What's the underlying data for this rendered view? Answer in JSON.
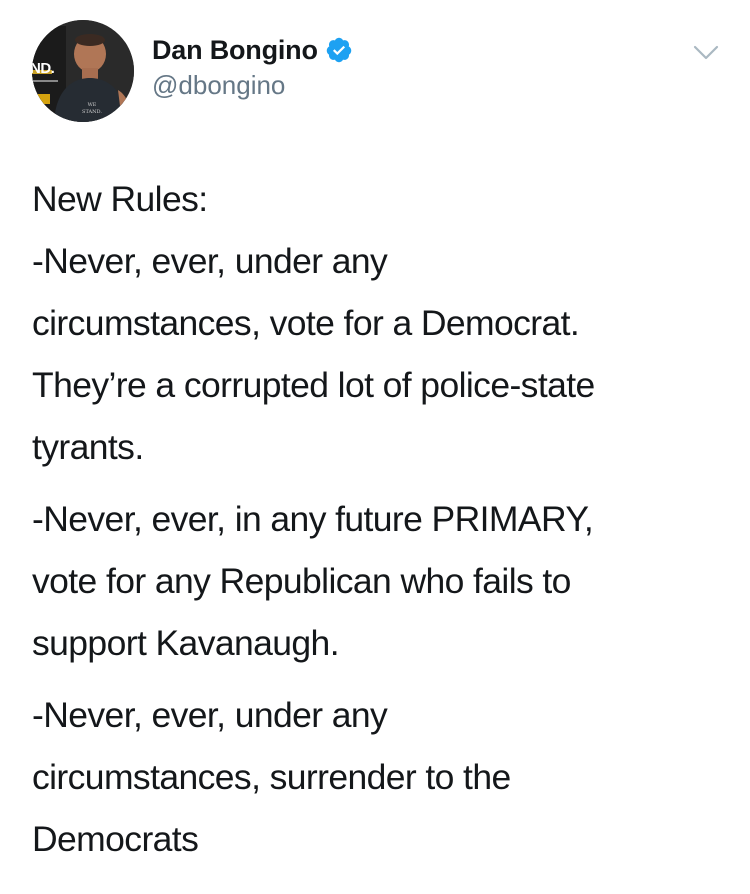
{
  "tweet": {
    "author": {
      "display_name": "Dan Bongino",
      "handle": "@dbongino",
      "verified": true,
      "avatar_text": "ND."
    },
    "menu_icon": "chevron-down-icon",
    "lines": {
      "l1": "New Rules:",
      "l2": "-Never, ever, under any",
      "l3": "circumstances, vote for a Democrat.",
      "l4": "They’re a corrupted lot of police-state",
      "l5": "tyrants.",
      "l6": "-Never, ever, in any future PRIMARY,",
      "l7": "vote for any Republican who fails to",
      "l8": "support Kavanaugh.",
      "l9": "-Never, ever, under any",
      "l10": "circumstances, surrender to the",
      "l11": "Democrats"
    }
  },
  "colors": {
    "text": "#14171a",
    "secondary": "#657786",
    "verified_blue": "#1da1f2",
    "chevron": "#aab8c2"
  }
}
